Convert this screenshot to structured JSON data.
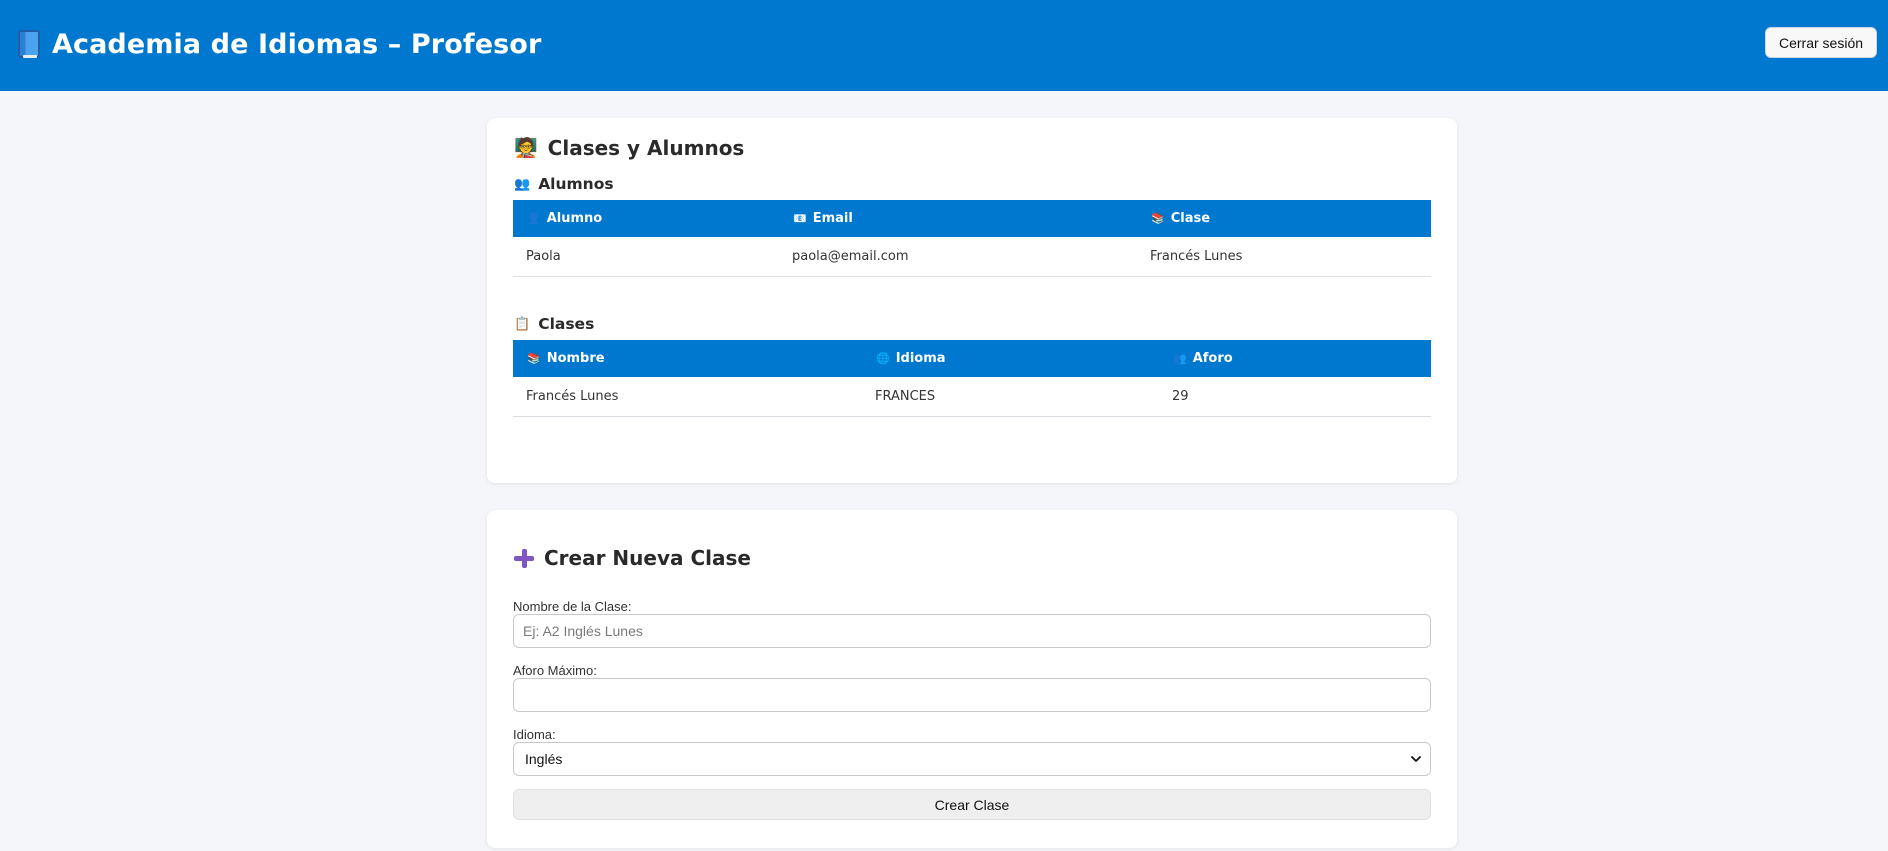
{
  "header": {
    "title": "Academia de Idiomas – Profesor",
    "logout_label": "Cerrar sesión"
  },
  "classes_section": {
    "title_icon": "🧑‍🏫",
    "title": "Clases y Alumnos",
    "students": {
      "icon": "👥",
      "title": "Alumnos",
      "columns": [
        {
          "icon": "👤",
          "label": "Alumno"
        },
        {
          "icon": "📧",
          "label": "Email"
        },
        {
          "icon": "📚",
          "label": "Clase"
        }
      ],
      "rows": [
        {
          "alumno": "Paola",
          "email": "paola@email.com",
          "clase": "Francés Lunes"
        }
      ]
    },
    "classes": {
      "icon": "📋",
      "title": "Clases",
      "columns": [
        {
          "icon": "📚",
          "label": "Nombre"
        },
        {
          "icon": "🌐",
          "label": "Idioma"
        },
        {
          "icon": "👥",
          "label": "Aforo"
        }
      ],
      "rows": [
        {
          "nombre": "Francés Lunes",
          "idioma": "FRANCES",
          "aforo": "29"
        }
      ]
    }
  },
  "create_form": {
    "title": "Crear Nueva Clase",
    "name_label": "Nombre de la Clase:",
    "name_placeholder": "Ej: A2 Inglés Lunes",
    "name_value": "",
    "capacity_label": "Aforo Máximo:",
    "capacity_value": "",
    "language_label": "Idioma:",
    "language_selected": "Inglés",
    "submit_label": "Crear Clase"
  },
  "colors": {
    "primary": "#0078cf",
    "background": "#f4f6fa",
    "accent_purple": "#7e57c2"
  },
  "icons": {
    "brand": "book-icon",
    "create": "plus-icon",
    "select": "chevron-down-icon"
  }
}
